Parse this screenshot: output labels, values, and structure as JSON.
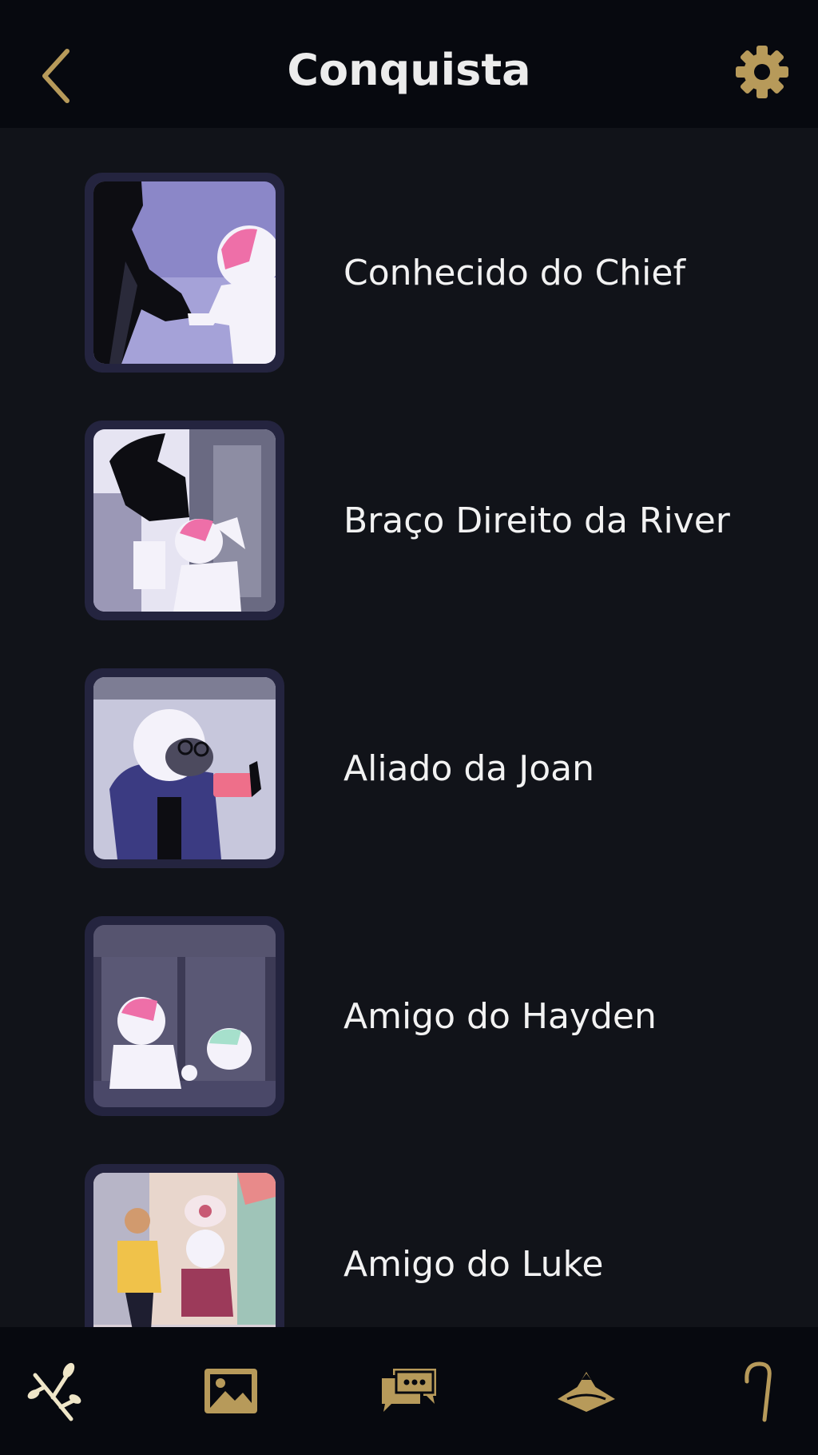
{
  "header": {
    "title": "Conquista",
    "back_icon": "chevron-left-icon",
    "settings_icon": "gear-icon"
  },
  "achievements": [
    {
      "label": "Conhecido do Chief"
    },
    {
      "label": "Braço Direito da River"
    },
    {
      "label": "Aliado da Joan"
    },
    {
      "label": "Amigo do Hayden"
    },
    {
      "label": "Amigo do Luke"
    }
  ],
  "bottom_nav": {
    "items": [
      {
        "icon": "branch-icon"
      },
      {
        "icon": "gallery-icon"
      },
      {
        "icon": "chat-icon"
      },
      {
        "icon": "hat-icon"
      },
      {
        "icon": "cane-icon"
      }
    ]
  },
  "colors": {
    "background": "#111319",
    "header_background": "#07090f",
    "accent_gold": "#b79a5a",
    "thumb_frame": "#24243f",
    "text": "#f2f2f2"
  }
}
